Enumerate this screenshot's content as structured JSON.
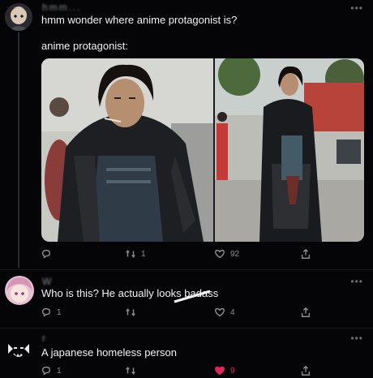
{
  "tweet1": {
    "name": "hmm...",
    "text": "hmm wonder where anime protagonist is?",
    "text2": "anime protagonist:",
    "actions": {
      "reply": "",
      "retweet": "1",
      "like": "92",
      "share": ""
    },
    "icons": [
      "reply-icon",
      "retweet-icon",
      "heart-icon",
      "share-icon"
    ]
  },
  "tweet2": {
    "name": "W",
    "text": "Who is this? He actually looks badass",
    "actions": {
      "reply": "1",
      "retweet": "",
      "like": "4",
      "share": ""
    }
  },
  "tweet3": {
    "name": "r",
    "text": "A japanese homeless person",
    "actions": {
      "reply": "1",
      "retweet": "",
      "like": "9",
      "share": ""
    },
    "accent_like": "#e0245e"
  },
  "more_label": "•••"
}
